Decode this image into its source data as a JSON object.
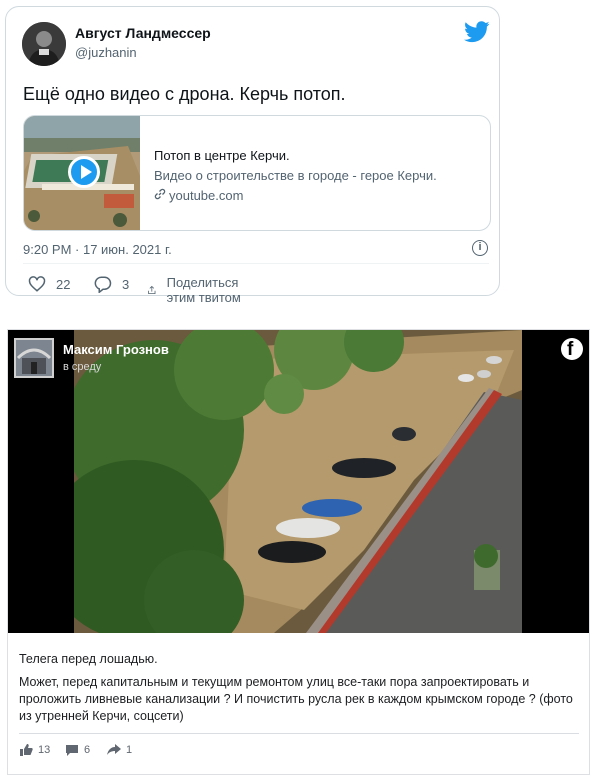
{
  "tweet": {
    "author_name": "Август Ландмессер",
    "handle": "@juzhanin",
    "text": "Ещё одно видео с дрона. Керчь потоп.",
    "link_card": {
      "title": "Потоп в центре Керчи.",
      "description": "Видео о строительстве в городе - герое Керчи.",
      "domain": "youtube.com"
    },
    "timestamp": "9:20 PM · 17 июн. 2021 г.",
    "info_label": "i",
    "likes": "22",
    "replies": "3",
    "share_label": "Поделиться этим твитом",
    "icons": [
      "twitter-bird-icon",
      "play-icon",
      "link-icon",
      "info-icon",
      "heart-icon",
      "reply-icon",
      "share-icon"
    ],
    "colors": {
      "accent": "#1d9bf0",
      "muted": "#536471",
      "border": "#cfd9de"
    }
  },
  "facebook": {
    "author_name": "Максим Грознов",
    "time": "в среду",
    "logo_letter": "f",
    "text_line1": "Телега перед лошадью.",
    "text_body": "Может, перед капитальным и текущим ремонтом улиц все-таки пора запроектировать и проложить ливневые канализации ? И почистить русла рек в каждом крымском городе ? (фото из утренней Керчи, соцсети)",
    "likes": "13",
    "comments": "6",
    "shares": "1",
    "icons": [
      "facebook-logo-icon",
      "like-icon",
      "comment-icon",
      "share-icon"
    ]
  }
}
